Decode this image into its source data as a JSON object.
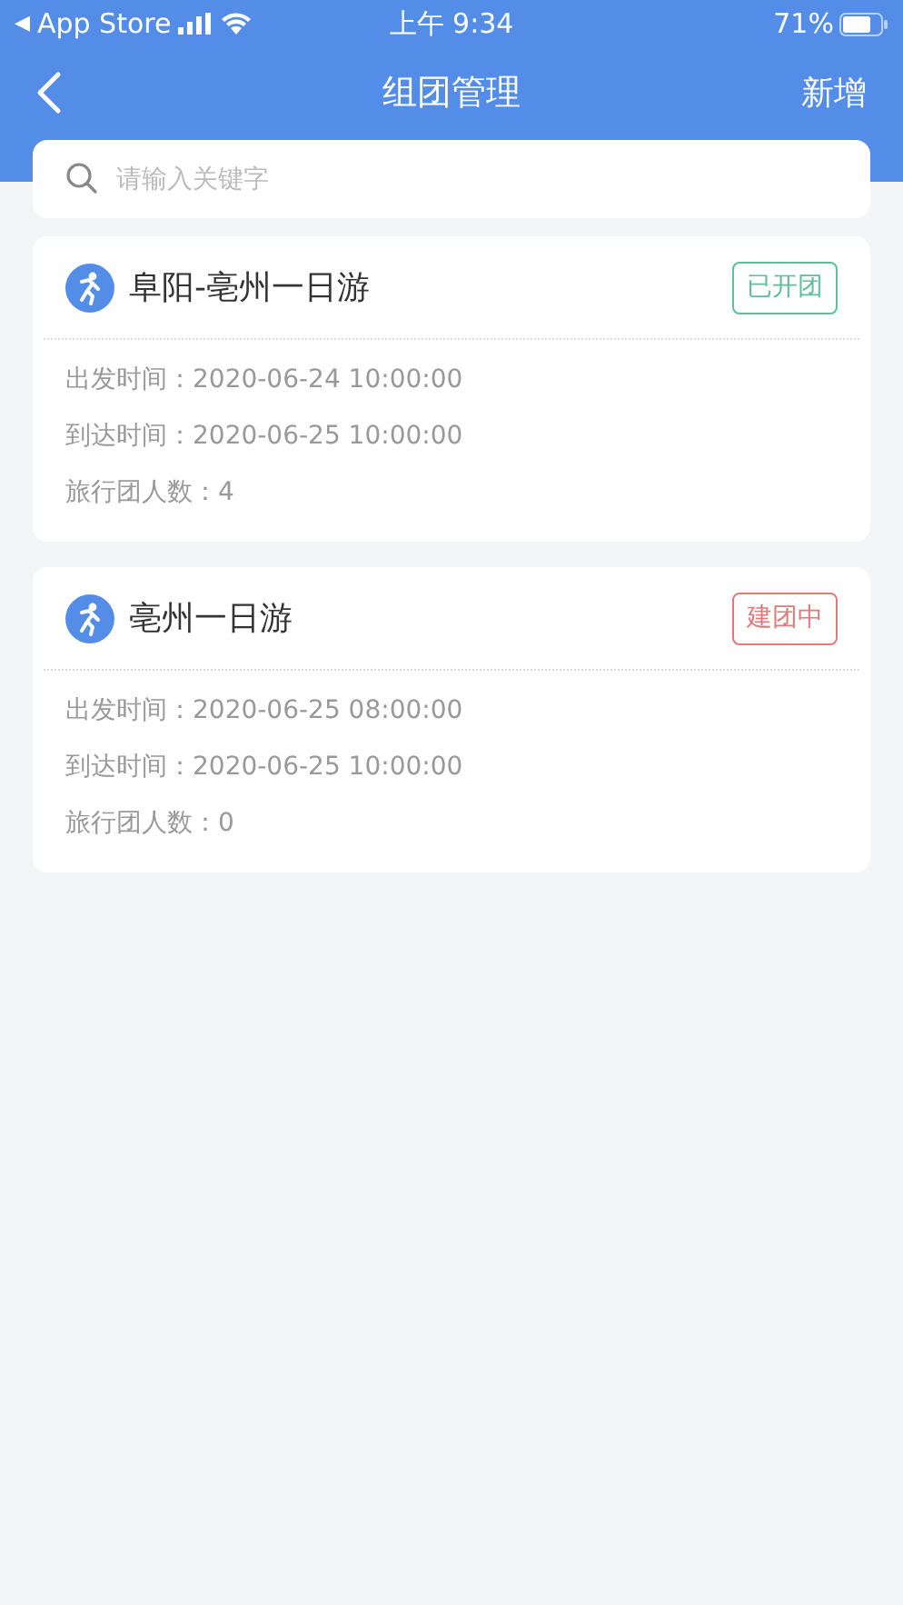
{
  "status_bar": {
    "back_arrow": "◀",
    "carrier": "App Store",
    "time": "上午 9:34",
    "battery": "71%"
  },
  "nav": {
    "title": "组团管理",
    "action": "新增"
  },
  "search": {
    "placeholder": "请输入关键字"
  },
  "groups": [
    {
      "name": "阜阳-亳州一日游",
      "status": "已开团",
      "color": "#5dbf9a",
      "lines": [
        "出发时间：2020-06-24 10:00:00",
        "到达时间：2020-06-25 10:00:00",
        "旅行团人数：4"
      ]
    },
    {
      "name": "亳州一日游",
      "status": "建团中",
      "color": "#e07a7a",
      "lines": [
        "出发时间：2020-06-25 08:00:00",
        "到达时间：2020-06-25 10:00:00",
        "旅行团人数：0"
      ]
    }
  ]
}
